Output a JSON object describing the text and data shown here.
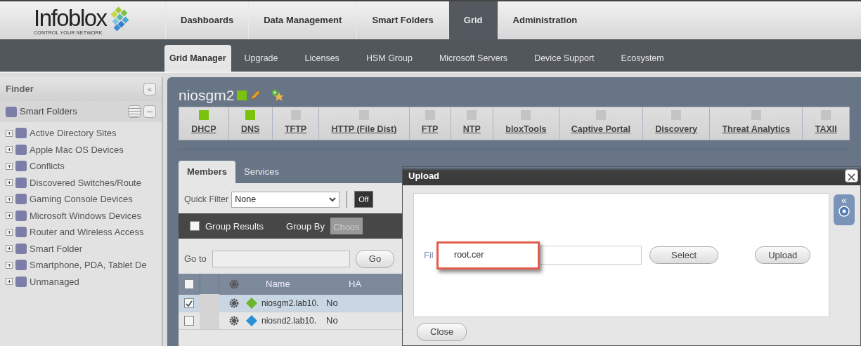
{
  "logo": {
    "name": "Infoblox",
    "tagline": "CONTROL YOUR NETWORK"
  },
  "main_tabs": [
    {
      "label": "Dashboards",
      "selected": false
    },
    {
      "label": "Data Management",
      "selected": false
    },
    {
      "label": "Smart Folders",
      "selected": false
    },
    {
      "label": "Grid",
      "selected": true
    },
    {
      "label": "Administration",
      "selected": false
    }
  ],
  "sub_tabs": [
    {
      "label": "Grid Manager",
      "selected": true
    },
    {
      "label": "Upgrade",
      "selected": false
    },
    {
      "label": "Licenses",
      "selected": false
    },
    {
      "label": "HSM Group",
      "selected": false
    },
    {
      "label": "Microsoft Servers",
      "selected": false
    },
    {
      "label": "Device Support",
      "selected": false
    },
    {
      "label": "Ecosystem",
      "selected": false
    }
  ],
  "finder": {
    "title": "Finder",
    "collapse": "«",
    "section": "Smart Folders",
    "items": [
      {
        "label": "Active Directory Sites",
        "expanded": false
      },
      {
        "label": "Apple Mac OS Devices",
        "expanded": false
      },
      {
        "label": "Conflicts",
        "expanded": false
      },
      {
        "label": "Discovered Switches/Route",
        "expanded": false
      },
      {
        "label": "Gaming Console Devices",
        "expanded": false
      },
      {
        "label": "Microsoft Windows Devices",
        "expanded": false
      },
      {
        "label": "Router and Wireless Access",
        "expanded": false
      },
      {
        "label": "Smart Folder",
        "expanded": false
      },
      {
        "label": "Smartphone, PDA, Tablet De",
        "expanded": false
      },
      {
        "label": "Unmanaged",
        "expanded": false
      }
    ]
  },
  "member": {
    "name": "niosgm2",
    "online": true
  },
  "services": [
    {
      "label": "DHCP",
      "on": true
    },
    {
      "label": "DNS",
      "on": true
    },
    {
      "label": "TFTP",
      "on": false
    },
    {
      "label": "HTTP (File Dist)",
      "on": false
    },
    {
      "label": "FTP",
      "on": false
    },
    {
      "label": "NTP",
      "on": false
    },
    {
      "label": "bloxTools",
      "on": false
    },
    {
      "label": "Captive Portal",
      "on": false
    },
    {
      "label": "Discovery",
      "on": false
    },
    {
      "label": "Threat Analytics",
      "on": false
    },
    {
      "label": "TAXII",
      "on": false
    }
  ],
  "panel_tabs": [
    {
      "label": "Members",
      "selected": true
    },
    {
      "label": "Services",
      "selected": false
    }
  ],
  "quick_filter": {
    "label": "Quick Filter",
    "value": "None",
    "toggle": "Off"
  },
  "group_results": {
    "label": "Group Results",
    "checked": false
  },
  "group_by": {
    "label": "Group By",
    "value": "Choos"
  },
  "goto": {
    "label": "Go to",
    "button": "Go"
  },
  "table": {
    "columns": [
      "Name",
      "HA"
    ],
    "all_checked": false,
    "rows": [
      {
        "kind": "master",
        "name": "niosgm2.lab10.",
        "ha": "No",
        "checked": true,
        "selected": true
      },
      {
        "kind": "member",
        "name": "niosnd2.lab10.",
        "ha": "No",
        "checked": false,
        "selected": false
      }
    ]
  },
  "dialog": {
    "title": "Upload",
    "file_label": "Fil",
    "file_value": "root.cer",
    "select": "Select",
    "upload": "Upload",
    "close": "Close",
    "side_collapse": "«"
  }
}
